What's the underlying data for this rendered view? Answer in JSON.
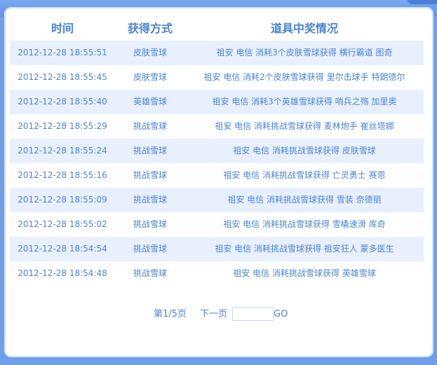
{
  "table": {
    "headers": {
      "time": "时间",
      "method": "获得方式",
      "prize": "道具中奖情况"
    },
    "rows": [
      {
        "time": "2012-12-28 18:55:51",
        "method": "皮肤雪球",
        "prize": "祖安 电信 消耗3个皮肤雪球获得 横行霸道 图奇"
      },
      {
        "time": "2012-12-28 18:55:45",
        "method": "皮肤雪球",
        "prize": "祖安 电信 消耗2个皮肤雪球获得 里尔击球手 特朗德尔"
      },
      {
        "time": "2012-12-28 18:55:40",
        "method": "英雄雪球",
        "prize": "祖安 电信 消耗3个英雄雪球获得 哨兵之殇 加里奥"
      },
      {
        "time": "2012-12-28 18:55:29",
        "method": "挑战雪球",
        "prize": "祖安 电信 消耗挑战雪球获得 麦林炮手 崔丝塔娜"
      },
      {
        "time": "2012-12-28 18:55:24",
        "method": "挑战雪球",
        "prize": "祖安 电信 消耗挑战雪球获得 皮肤雪球"
      },
      {
        "time": "2012-12-28 18:55:16",
        "method": "挑战雪球",
        "prize": "祖安 电信 消耗挑战雪球获得 亡灵勇士 赛恩"
      },
      {
        "time": "2012-12-28 18:55:09",
        "method": "挑战雪球",
        "prize": "祖安 电信 消耗挑战雪球获得 雪装 奈德丽"
      },
      {
        "time": "2012-12-28 18:55:02",
        "method": "挑战雪球",
        "prize": "祖安 电信 消耗挑战雪球获得 雪橇速滑 库奇"
      },
      {
        "time": "2012-12-28 18:54:54",
        "method": "挑战雪球",
        "prize": "祖安 电信 消耗挑战雪球获得 祖安狂人 蒙多医生"
      },
      {
        "time": "2012-12-28 18:54:48",
        "method": "挑战雪球",
        "prize": "祖安 电信 消耗挑战雪球获得 英雄雪球"
      }
    ]
  },
  "pager": {
    "page_info": "第1/5页",
    "next_label": "下一页",
    "page_input_value": "",
    "go_label": "GO"
  }
}
